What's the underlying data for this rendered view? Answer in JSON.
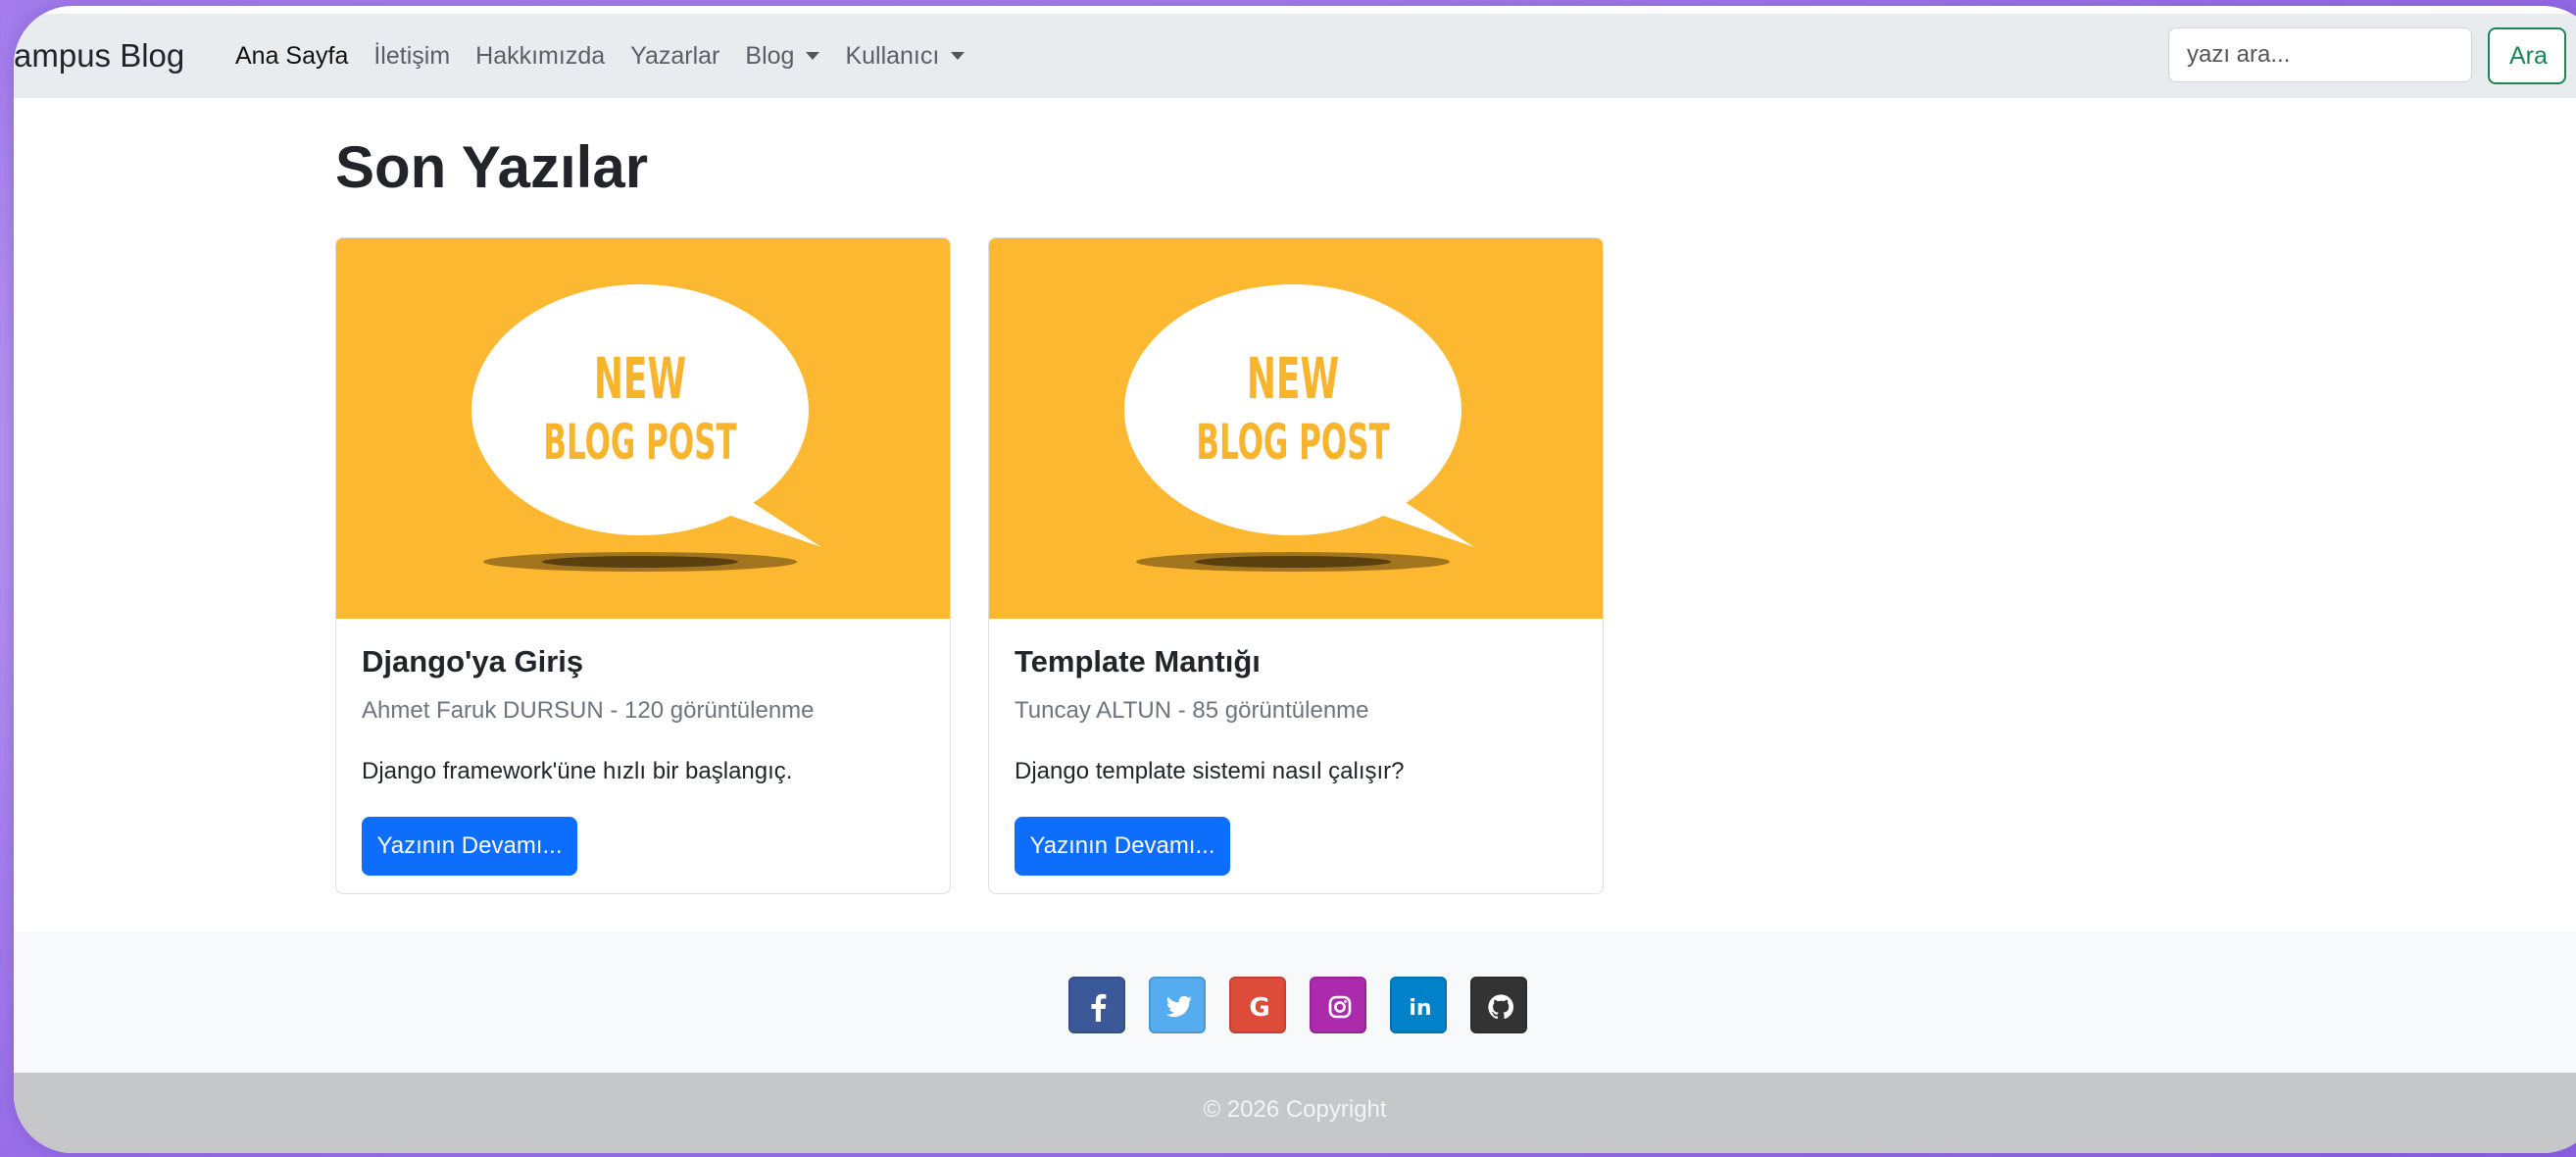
{
  "navbar": {
    "brand": "Kampus Blog",
    "brand_visible": "ampus Blog",
    "items": [
      {
        "label": "Ana Sayfa",
        "active": true
      },
      {
        "label": "İletişim"
      },
      {
        "label": "Hakkımızda"
      },
      {
        "label": "Yazarlar"
      },
      {
        "label": "Blog",
        "dropdown": true
      },
      {
        "label": "Kullanıcı",
        "dropdown": true
      }
    ],
    "search": {
      "placeholder": "yazı ara...",
      "button": "Ara"
    }
  },
  "main": {
    "title": "Son Yazılar",
    "posts": [
      {
        "image_text": [
          "NEW",
          "BLOG POST"
        ],
        "title": "Django'ya Giriş",
        "meta": "Ahmet Faruk DURSUN - 120 görüntülenme",
        "summary": "Django framework'üne hızlı bir başlangıç.",
        "button": "Yazının Devamı..."
      },
      {
        "image_text": [
          "NEW",
          "BLOG POST"
        ],
        "title": "Template Mantığı",
        "meta": "Tuncay ALTUN - 85 görüntülenme",
        "summary": "Django template sistemi nasıl çalışır?",
        "button": "Yazının Devamı..."
      }
    ]
  },
  "footer": {
    "social": [
      {
        "icon": "facebook-icon",
        "color": "#3b5998",
        "glyph": "f"
      },
      {
        "icon": "twitter-icon",
        "color": "#55acee",
        "glyph": "t"
      },
      {
        "icon": "google-icon",
        "color": "#dd4b39",
        "glyph": "G"
      },
      {
        "icon": "instagram-icon",
        "color": "#ac2bac",
        "glyph": "ig"
      },
      {
        "icon": "linkedin-icon",
        "color": "#0082ca",
        "glyph": "in"
      },
      {
        "icon": "github-icon",
        "color": "#333333",
        "glyph": "gh"
      }
    ],
    "copyright": "© 2026 Copyright"
  },
  "colors": {
    "accent": "#0d6efd",
    "success": "#198754",
    "image_bg": "#fbb830",
    "image_text": "#f7b42c"
  }
}
